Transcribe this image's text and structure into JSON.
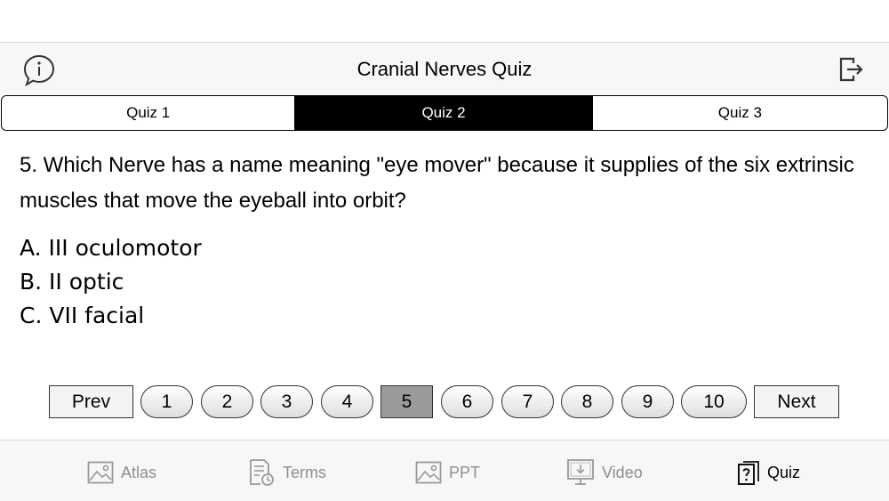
{
  "header": {
    "title": "Cranial Nerves Quiz"
  },
  "quiz_tabs": [
    {
      "label": "Quiz 1",
      "active": false
    },
    {
      "label": "Quiz 2",
      "active": true
    },
    {
      "label": "Quiz 3",
      "active": false
    }
  ],
  "question": {
    "text": "5. Which Nerve has a name meaning \"eye mover\" because it supplies of the six extrinsic muscles that move the eyeball into orbit?"
  },
  "answers": [
    "A. III oculomotor",
    "B. II optic",
    "C. VII facial"
  ],
  "pagination": {
    "prev_label": "Prev",
    "next_label": "Next",
    "pages": [
      "1",
      "2",
      "3",
      "4",
      "5",
      "6",
      "7",
      "8",
      "9",
      "10"
    ],
    "current": 5
  },
  "bottom_tabs": [
    {
      "label": "Atlas",
      "icon": "image-icon",
      "selected": false
    },
    {
      "label": "Terms",
      "icon": "document-clock-icon",
      "selected": false
    },
    {
      "label": "PPT",
      "icon": "image-icon",
      "selected": false
    },
    {
      "label": "Video",
      "icon": "monitor-download-icon",
      "selected": false
    },
    {
      "label": "Quiz",
      "icon": "quiz-icon",
      "selected": true
    }
  ],
  "colors": {
    "bar_background": "#f7f7f7",
    "active_segment": "#000000",
    "current_page": "#9a9a9a",
    "inactive_tab_text": "#8e8e8e"
  }
}
